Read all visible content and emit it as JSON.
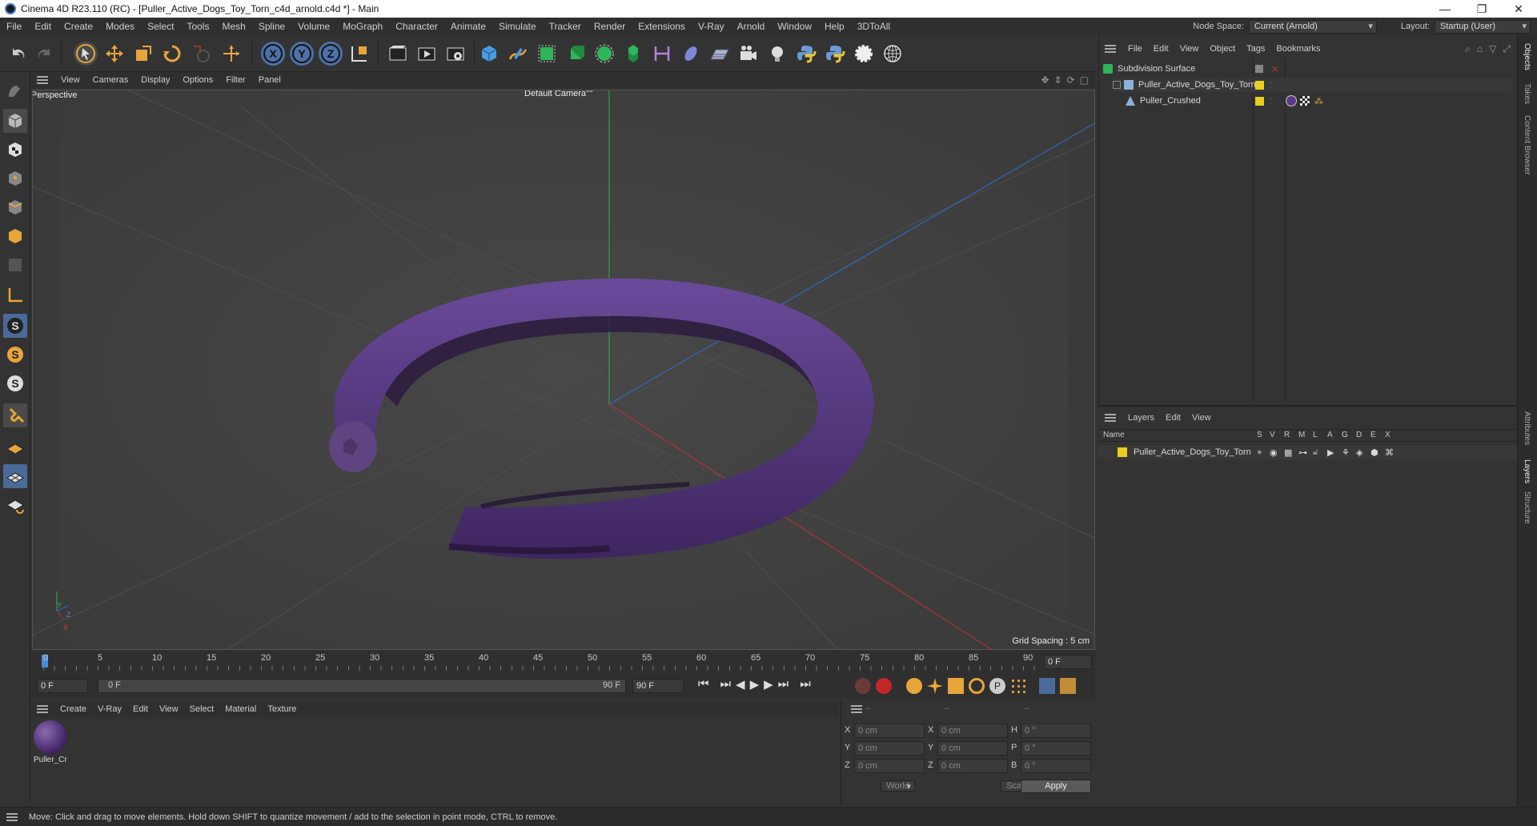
{
  "window": {
    "title": "Cinema 4D R23.110 (RC) - [Puller_Active_Dogs_Toy_Torn_c4d_arnold.c4d *] - Main",
    "minimize": "—",
    "maximize": "❐",
    "close": "✕"
  },
  "menubar": {
    "items": [
      "File",
      "Edit",
      "Create",
      "Modes",
      "Select",
      "Tools",
      "Mesh",
      "Spline",
      "Volume",
      "MoGraph",
      "Character",
      "Animate",
      "Simulate",
      "Tracker",
      "Render",
      "Extensions",
      "V-Ray",
      "Arnold",
      "Window",
      "Help",
      "3DToAll"
    ],
    "node_space_label": "Node Space:",
    "node_space_value": "Current (Arnold)",
    "layout_label": "Layout:",
    "layout_value": "Startup (User)"
  },
  "viewport": {
    "menu": [
      "View",
      "Cameras",
      "Display",
      "Options",
      "Filter",
      "Panel"
    ],
    "view_name": "Perspective",
    "camera": "Default Camera",
    "camera_suffix": "°°",
    "grid_spacing": "Grid Spacing : 5 cm",
    "axis_y": "Y",
    "axis_z": "Z",
    "axis_x": "X"
  },
  "timeline": {
    "ticks": [
      "0",
      "5",
      "10",
      "15",
      "20",
      "25",
      "30",
      "35",
      "40",
      "45",
      "50",
      "55",
      "60",
      "65",
      "70",
      "75",
      "80",
      "85",
      "90"
    ],
    "current_frame": "0 F"
  },
  "transport": {
    "start_field": "0 F",
    "range_start": "0 F",
    "range_end": "90 F",
    "end_field": "90 F"
  },
  "material_manager": {
    "menu": [
      "Create",
      "V-Ray",
      "Edit",
      "View",
      "Select",
      "Material",
      "Texture"
    ],
    "material_name": "Puller_Cr"
  },
  "coordinates": {
    "header": [
      "--",
      "--",
      "--"
    ],
    "rows": [
      {
        "a": "X",
        "av": "0 cm",
        "b": "X",
        "bv": "0 cm",
        "c": "H",
        "cv": "0 °"
      },
      {
        "a": "Y",
        "av": "0 cm",
        "b": "Y",
        "bv": "0 cm",
        "c": "P",
        "cv": "0 °"
      },
      {
        "a": "Z",
        "av": "0 cm",
        "b": "Z",
        "bv": "0 cm",
        "c": "B",
        "cv": "0 °"
      }
    ],
    "space": "World",
    "mode": "Scale",
    "apply": "Apply"
  },
  "status": "Move: Click and drag to move elements. Hold down SHIFT to quantize movement / add to the selection in point mode, CTRL to remove.",
  "object_manager": {
    "menu": [
      "File",
      "Edit",
      "View",
      "Object",
      "Tags",
      "Bookmarks"
    ],
    "objects": [
      {
        "name": "Subdivision Surface"
      },
      {
        "name": "Puller_Active_Dogs_Toy_Torn"
      },
      {
        "name": "Puller_Crushed"
      }
    ]
  },
  "layer_manager": {
    "menu": [
      "Layers",
      "Edit",
      "View"
    ],
    "col_name": "Name",
    "cols": [
      "S",
      "V",
      "R",
      "M",
      "L",
      "A",
      "G",
      "D",
      "E",
      "X"
    ],
    "layer_name": "Puller_Active_Dogs_Toy_Torn"
  },
  "side_tabs": [
    "Objects",
    "Takes",
    "Content Browser",
    "Attributes",
    "Layers",
    "Structure"
  ],
  "colors": {
    "accent": "#4a8ad8",
    "layer_yellow": "#e8d020",
    "torus": "#5b3a86"
  }
}
